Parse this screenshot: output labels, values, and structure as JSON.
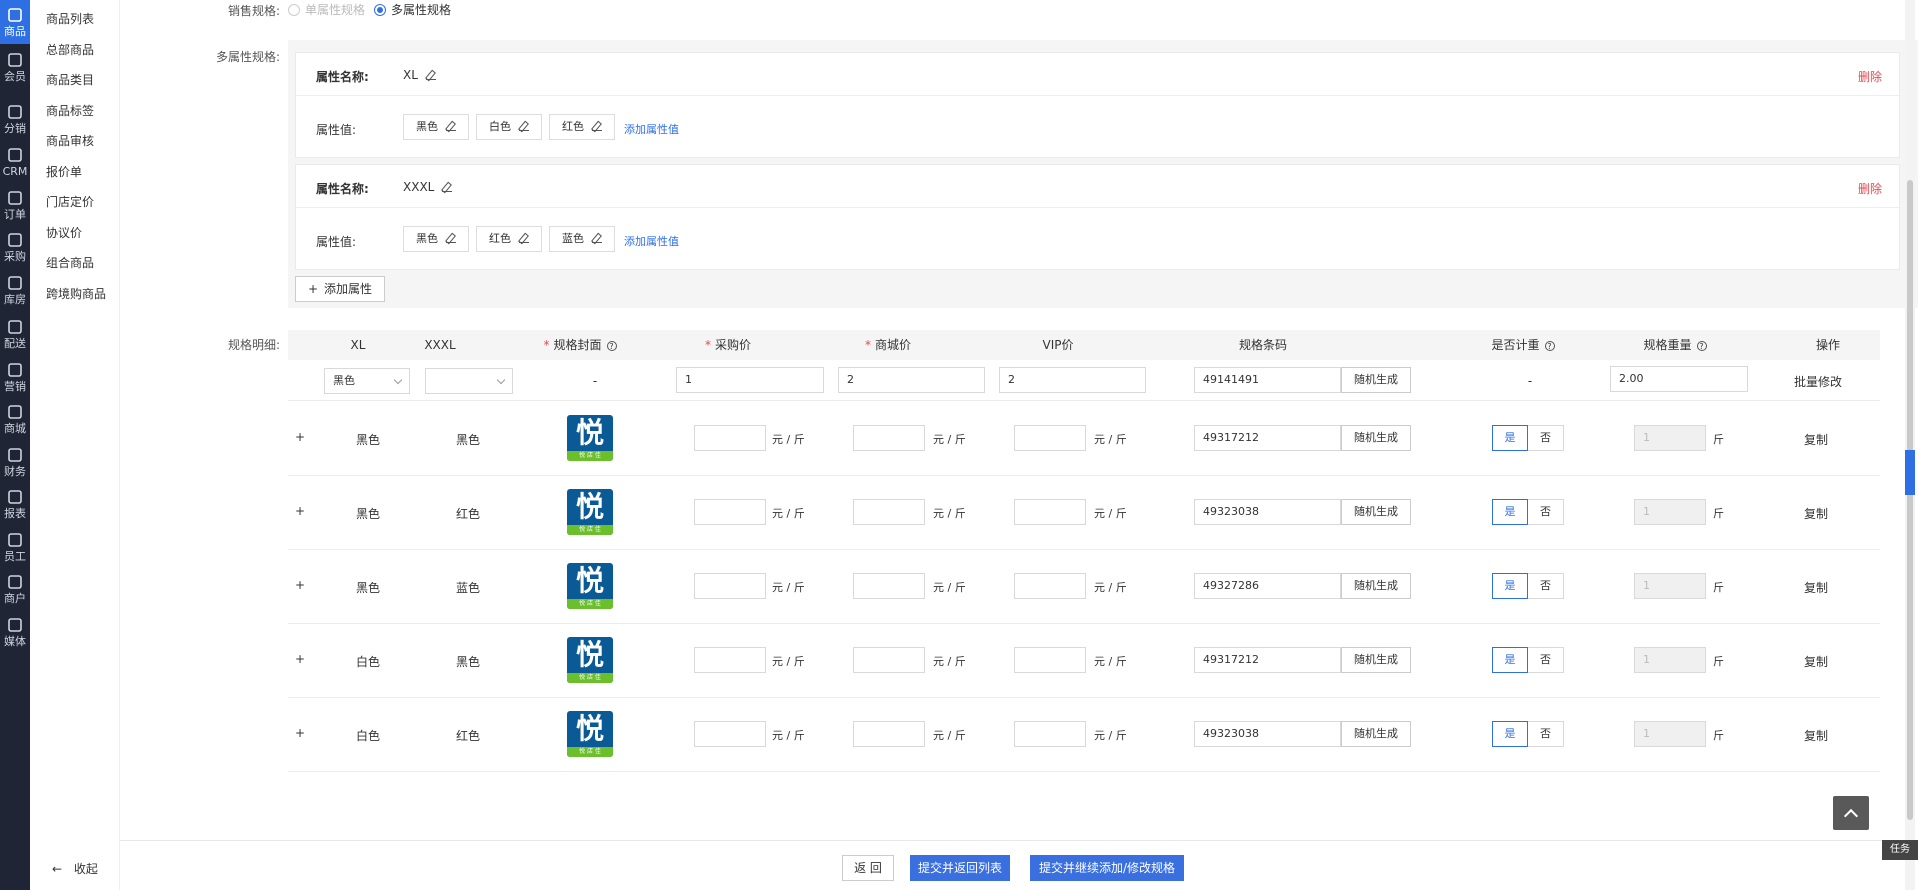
{
  "rail": {
    "items": [
      {
        "label": "商品",
        "icon": "bag-icon"
      },
      {
        "label": "会员",
        "icon": "user-icon"
      },
      {
        "label": "分销",
        "icon": "network-icon"
      },
      {
        "label": "CRM",
        "icon": "crm-icon"
      },
      {
        "label": "订单",
        "icon": "order-icon"
      },
      {
        "label": "采购",
        "icon": "clipboard-icon"
      },
      {
        "label": "库房",
        "icon": "warehouse-icon"
      },
      {
        "label": "配送",
        "icon": "truck-icon"
      },
      {
        "label": "营销",
        "icon": "gift-icon"
      },
      {
        "label": "商城",
        "icon": "home-icon"
      },
      {
        "label": "财务",
        "icon": "yen-icon"
      },
      {
        "label": "报表",
        "icon": "chart-icon"
      },
      {
        "label": "员工",
        "icon": "badge-icon"
      },
      {
        "label": "商户",
        "icon": "shop-icon"
      },
      {
        "label": "媒体",
        "icon": "play-icon"
      }
    ],
    "active_color": "#2f6fe4"
  },
  "submenu": {
    "items": [
      "商品列表",
      "总部商品",
      "商品类目",
      "商品标签",
      "商品审核",
      "报价单",
      "门店定价",
      "协议价",
      "组合商品",
      "跨境购商品"
    ],
    "collapse_label": "收起"
  },
  "form": {
    "sale_spec_label": "销售规格:",
    "single_option": "单属性规格",
    "multi_option": "多属性规格",
    "multi_spec_label": "多属性规格:",
    "attr_name_label": "属性名称:",
    "attr_value_label": "属性值:",
    "add_value_label": "添加属性值",
    "delete_label": "删除",
    "add_attr_label": "添加属性",
    "attrs": [
      {
        "name": "XL",
        "values": [
          "黑色",
          "白色",
          "红色"
        ]
      },
      {
        "name": "XXXL",
        "values": [
          "黑色",
          "红色",
          "蓝色"
        ]
      }
    ],
    "detail_label": "规格明细:"
  },
  "table": {
    "headers": {
      "xl": "XL",
      "xxxl": "XXXL",
      "cover": "规格封面",
      "purchase": "采购价",
      "mall": "商城价",
      "vip": "VIP价",
      "barcode": "规格条码",
      "weighed": "是否计重",
      "weight": "规格重量",
      "action": "操作"
    },
    "batch": {
      "xl_select": "黑色",
      "xxxl_select": "",
      "cover": "-",
      "purchase": "1",
      "mall": "2",
      "vip": "2",
      "barcode": "49141491",
      "weighed": "-",
      "weight": "2.00",
      "batch_action": "批量修改"
    },
    "random_label": "随机生成",
    "unit_label": "元 / 斤",
    "weight_unit": "斤",
    "yes_label": "是",
    "no_label": "否",
    "copy_label": "复制",
    "expand_glyph": "+",
    "logo_char": "悦",
    "logo_band": "悦 店 佳",
    "rows": [
      {
        "xl": "黑色",
        "xxxl": "黑色",
        "barcode": "49317212",
        "weight": "1"
      },
      {
        "xl": "黑色",
        "xxxl": "红色",
        "barcode": "49323038",
        "weight": "1"
      },
      {
        "xl": "黑色",
        "xxxl": "蓝色",
        "barcode": "49327286",
        "weight": "1"
      },
      {
        "xl": "白色",
        "xxxl": "黑色",
        "barcode": "49317212",
        "weight": "1"
      },
      {
        "xl": "白色",
        "xxxl": "红色",
        "barcode": "49323038",
        "weight": "1"
      }
    ]
  },
  "footer": {
    "back_label": "返 回",
    "submit_return_label": "提交并返回列表",
    "submit_continue_label": "提交并继续添加/修改规格"
  },
  "misc": {
    "task_label": "任务"
  }
}
